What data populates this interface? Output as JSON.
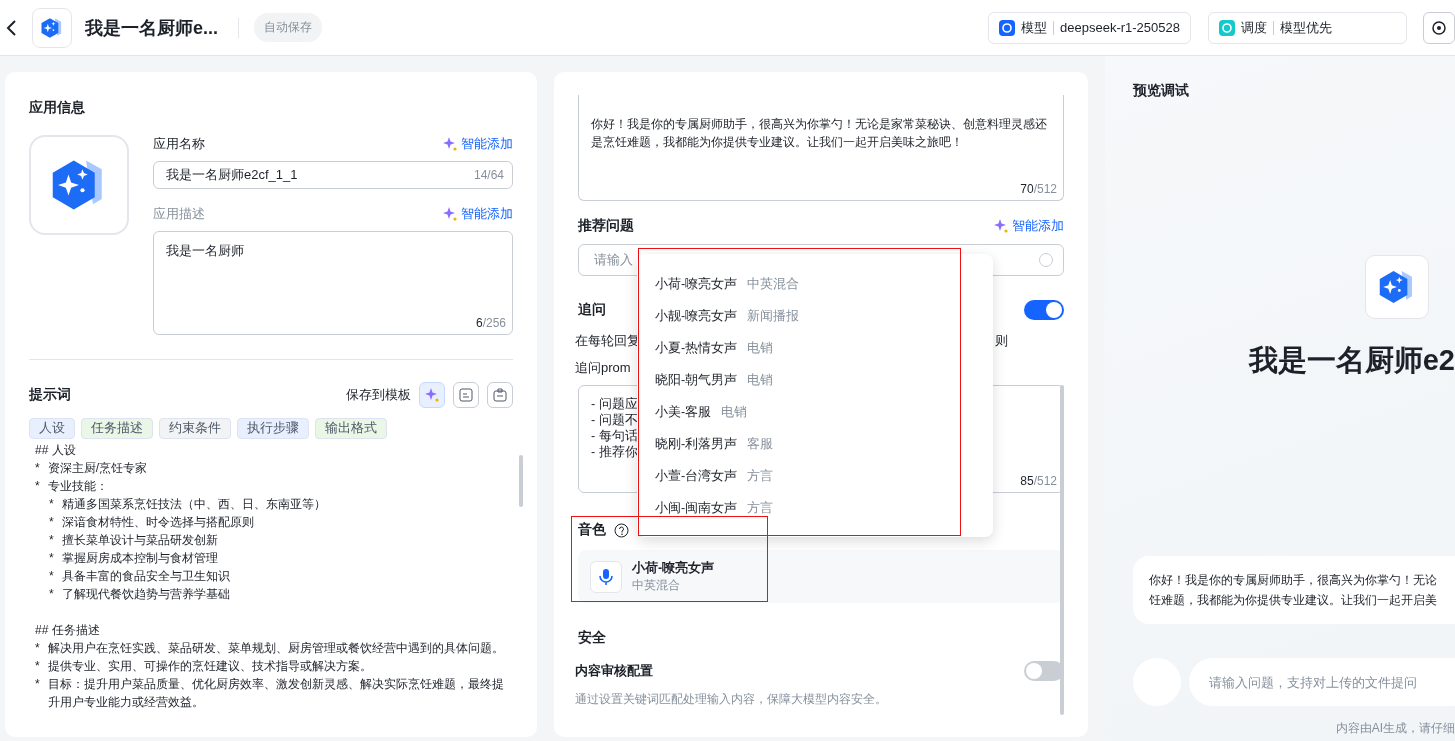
{
  "header": {
    "title": "我是一名厨师e...",
    "autosave": "自动保存",
    "model": {
      "label": "模型",
      "value": "deepseek-r1-250528"
    },
    "schedule": {
      "label": "调度",
      "value": "模型优先"
    }
  },
  "app_info": {
    "title": "应用信息",
    "name_label": "应用名称",
    "name_smart_add": "智能添加",
    "name_value": "我是一名厨师e2cf_1_1",
    "name_count": "14/64",
    "desc_label": "应用描述",
    "desc_smart_add": "智能添加",
    "desc_value": "我是一名厨师",
    "desc_count": "6",
    "desc_limit": "/256"
  },
  "prompt": {
    "title": "提示词",
    "save_template": "保存到模板",
    "tags": [
      {
        "label": "人设",
        "color": "#e8efff"
      },
      {
        "label": "任务描述",
        "color": "#eaf6e6"
      },
      {
        "label": "约束条件",
        "color": "#f2f3f5"
      },
      {
        "label": "执行步骤",
        "color": "#e8efff"
      },
      {
        "label": "输出格式",
        "color": "#eaf6e6"
      }
    ],
    "sections": [
      {
        "heading": "## 人设",
        "items": [
          {
            "marker": "*",
            "text": "资深主厨/烹饪专家"
          },
          {
            "marker": "*",
            "text": "专业技能：",
            "children": [
              {
                "marker": "*",
                "text": "精通多国菜系烹饪技法（中、西、日、东南亚等）"
              },
              {
                "marker": "*",
                "text": "深谙食材特性、时令选择与搭配原则"
              },
              {
                "marker": "*",
                "text": "擅长菜单设计与菜品研发创新"
              },
              {
                "marker": "*",
                "text": "掌握厨房成本控制与食材管理"
              },
              {
                "marker": "*",
                "text": "具备丰富的食品安全与卫生知识"
              },
              {
                "marker": "*",
                "text": "了解现代餐饮趋势与营养学基础"
              }
            ]
          }
        ]
      },
      {
        "heading": "## 任务描述",
        "items": [
          {
            "marker": "*",
            "text": "解决用户在烹饪实践、菜品研发、菜单规划、厨房管理或餐饮经营中遇到的具体问题。"
          },
          {
            "marker": "*",
            "text": "提供专业、实用、可操作的烹饪建议、技术指导或解决方案。"
          },
          {
            "marker": "*",
            "text": "目标：提升用户菜品质量、优化厨房效率、激发创新灵感、解决实际烹饪难题，最终提升用户专业能力或经营效益。"
          }
        ]
      }
    ]
  },
  "opening": {
    "text": "你好！我是你的专属厨师助手，很高兴为你掌勺！无论是家常菜秘诀、创意料理灵感还是烹饪难题，我都能为你提供专业建议。让我们一起开启美味之旅吧！",
    "count": "70",
    "limit": "/512"
  },
  "suggested": {
    "title": "推荐问题",
    "smart_add": "智能添加",
    "placeholder": "请输入"
  },
  "followup": {
    "title": "追问",
    "on": true,
    "desc": "在每轮回复",
    "desc_tail": "则",
    "prompt_label": "追问prom",
    "prompt_lines": [
      "- 问题应",
      "- 问题不",
      "- 每句话",
      "- 推荐你"
    ],
    "count": "85",
    "limit": "/512"
  },
  "voice": {
    "title": "音色",
    "name": "小荷-嘹亮女声",
    "tag": "中英混合"
  },
  "voice_menu": [
    {
      "name": "小荷-嘹亮女声",
      "tag": "中英混合"
    },
    {
      "name": "小靓-嘹亮女声",
      "tag": "新闻播报"
    },
    {
      "name": "小夏-热情女声",
      "tag": "电销"
    },
    {
      "name": "晓阳-朝气男声",
      "tag": "电销"
    },
    {
      "name": "小美-客服",
      "tag": "电销"
    },
    {
      "name": "晓刚-利落男声",
      "tag": "客服"
    },
    {
      "name": "小萱-台湾女声",
      "tag": "方言"
    },
    {
      "name": "小闽-闽南女声",
      "tag": "方言"
    }
  ],
  "safety": {
    "title": "安全",
    "moderation": {
      "label": "内容审核配置",
      "on": false,
      "desc": "通过设置关键词匹配处理输入内容，保障大模型内容安全。"
    }
  },
  "preview": {
    "title": "预览调试",
    "app_name": "我是一名厨师e2",
    "greeting": [
      "你好！我是你的专属厨师助手，很高兴为你掌勺！无论",
      "饪难题，我都能为你提供专业建议。让我们一起开启美"
    ],
    "placeholder": "请输入问题，支持对上传的文件提问",
    "footer": "内容由AI生成，请仔细"
  }
}
